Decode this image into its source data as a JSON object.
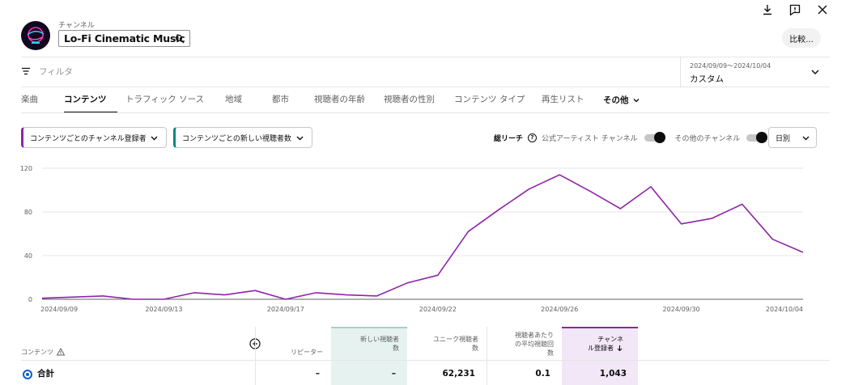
{
  "header": {
    "channel_label": "チャンネル",
    "channel_name": "Lo-Fi Cinematic Music",
    "compare_button": "比較..."
  },
  "filter": {
    "placeholder": "フィルタ"
  },
  "date_range": {
    "range": "2024/09/09～2024/10/04",
    "preset": "カスタム"
  },
  "tabs": [
    {
      "label": "楽曲"
    },
    {
      "label": "コンテンツ",
      "active": true
    },
    {
      "label": "トラフィック ソース"
    },
    {
      "label": "地域"
    },
    {
      "label": "都市"
    },
    {
      "label": "視聴者の年齢"
    },
    {
      "label": "視聴者の性別"
    },
    {
      "label": "コンテンツ タイプ"
    },
    {
      "label": "再生リスト"
    },
    {
      "label": "その他"
    }
  ],
  "metrics": {
    "primary": "コンテンツごとのチャンネル登録者",
    "secondary": "コンテンツごとの新しい視聴者数",
    "primary_color": "#8e24aa",
    "secondary_color": "#00897b"
  },
  "reach": {
    "label": "総リーチ",
    "help": "?",
    "toggle_official": "公式アーティスト チャンネル",
    "toggle_other": "その他のチャンネル"
  },
  "period": {
    "label": "日別"
  },
  "chart_data": {
    "type": "line",
    "ylim": [
      0,
      120
    ],
    "yticks": [
      0,
      40,
      80,
      120
    ],
    "xtick_labels": [
      "2024/09/09",
      "2024/09/13",
      "2024/09/17",
      "2024/09/22",
      "2024/09/26",
      "2024/09/30",
      "2024/10/04"
    ],
    "series": [
      {
        "color": "#8e24aa",
        "x": [
          "2024/09/09",
          "2024/09/10",
          "2024/09/11",
          "2024/09/12",
          "2024/09/13",
          "2024/09/14",
          "2024/09/15",
          "2024/09/16",
          "2024/09/17",
          "2024/09/18",
          "2024/09/19",
          "2024/09/20",
          "2024/09/21",
          "2024/09/22",
          "2024/09/23",
          "2024/09/24",
          "2024/09/25",
          "2024/09/26",
          "2024/09/27",
          "2024/09/28",
          "2024/09/29",
          "2024/09/30",
          "2024/10/01",
          "2024/10/02",
          "2024/10/03",
          "2024/10/04"
        ],
        "values": [
          1,
          2,
          3,
          0,
          0,
          6,
          4,
          8,
          0,
          6,
          4,
          3,
          15,
          22,
          62,
          82,
          101,
          114,
          99,
          83,
          103,
          69,
          74,
          87,
          55,
          43
        ]
      }
    ]
  },
  "table": {
    "headers": {
      "content": "コンテンツ",
      "repeaters": "リピーター",
      "new_viewers": [
        "新しい視聴者",
        "数"
      ],
      "unique_viewers": [
        "ユニーク視聴者",
        "数"
      ],
      "avg_views": [
        "視聴者あたり",
        "の平均視聴回",
        "数"
      ],
      "subscribers": [
        "チャンネ",
        "ル登録者"
      ]
    },
    "total": {
      "label": "合計",
      "repeaters": "–",
      "new_viewers": "–",
      "unique_viewers": "62,231",
      "avg_views": "0.1",
      "subscribers": "1,043"
    }
  }
}
